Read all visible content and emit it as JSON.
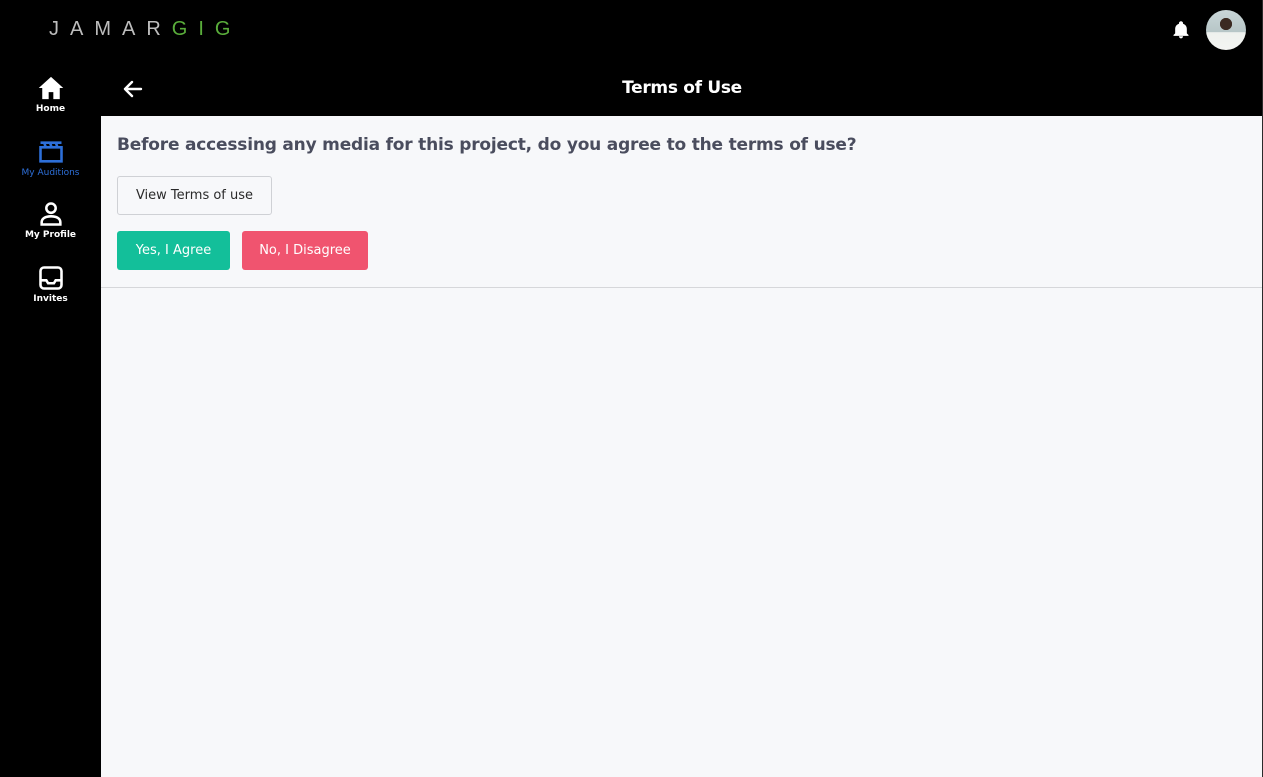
{
  "app": {
    "logo_primary": "JAMAR",
    "logo_accent": "GIG",
    "colors": {
      "accent_green": "#5aae3b",
      "active_nav": "#2d6fd9",
      "agree": "#13bf9a",
      "disagree": "#f0546f"
    }
  },
  "topbar": {
    "notification_icon": "bell-icon",
    "avatar_icon": "user-avatar"
  },
  "sidebar": {
    "items": [
      {
        "label": "Home",
        "icon": "home-icon",
        "active": false
      },
      {
        "label": "My Auditions",
        "icon": "clapperboard-icon",
        "active": true
      },
      {
        "label": "My Profile",
        "icon": "person-icon",
        "active": false
      },
      {
        "label": "Invites",
        "icon": "inbox-icon",
        "active": false
      }
    ]
  },
  "header": {
    "title": "Terms of Use",
    "back_icon": "arrow-left-icon"
  },
  "main": {
    "question": "Before accessing any media for this project, do you agree to the terms of use?",
    "view_terms_label": "View Terms of use",
    "agree_label": "Yes, I Agree",
    "disagree_label": "No, I Disagree"
  }
}
